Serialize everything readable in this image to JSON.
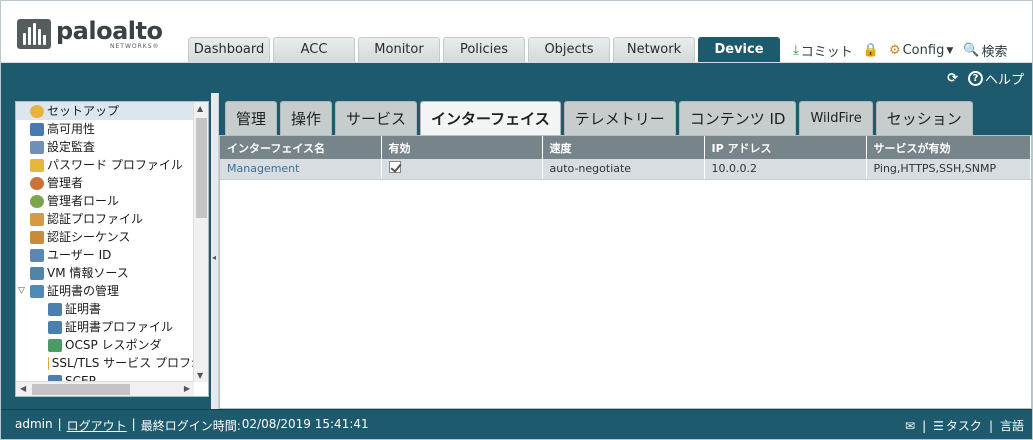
{
  "header": {
    "brand": "paloalto",
    "brand_sub": "NETWORKS®",
    "tabs": [
      {
        "label": "Dashboard"
      },
      {
        "label": "ACC"
      },
      {
        "label": "Monitor"
      },
      {
        "label": "Policies"
      },
      {
        "label": "Objects"
      },
      {
        "label": "Network"
      },
      {
        "label": "Device"
      }
    ],
    "commit_label": "コミット",
    "config_label": "Config",
    "search_label": "検索"
  },
  "band": {
    "help_label": "ヘルプ"
  },
  "sidebar": {
    "items": [
      {
        "label": "セットアップ",
        "icon": "setup-icon"
      },
      {
        "label": "高可用性",
        "icon": "high-availability-icon"
      },
      {
        "label": "設定監査",
        "icon": "config-audit-icon"
      },
      {
        "label": "パスワード プロファイル",
        "icon": "password-profile-icon"
      },
      {
        "label": "管理者",
        "icon": "admin-icon"
      },
      {
        "label": "管理者ロール",
        "icon": "admin-role-icon"
      },
      {
        "label": "認証プロファイル",
        "icon": "auth-profile-icon"
      },
      {
        "label": "認証シーケンス",
        "icon": "auth-sequence-icon"
      },
      {
        "label": "ユーザー ID",
        "icon": "user-id-icon"
      },
      {
        "label": "VM 情報ソース",
        "icon": "vm-info-icon"
      },
      {
        "label": "証明書の管理",
        "icon": "cert-management-icon"
      },
      {
        "label": "証明書",
        "icon": "certificate-icon"
      },
      {
        "label": "証明書プロファイル",
        "icon": "cert-profile-icon"
      },
      {
        "label": "OCSP レスポンダ",
        "icon": "ocsp-icon"
      },
      {
        "label": "SSL/TLS サービス プロフ:",
        "icon": "ssl-tls-icon"
      },
      {
        "label": "SCEP",
        "icon": "scep-icon"
      }
    ]
  },
  "subtabs": [
    {
      "label": "管理"
    },
    {
      "label": "操作"
    },
    {
      "label": "サービス"
    },
    {
      "label": "インターフェイス"
    },
    {
      "label": "テレメトリー"
    },
    {
      "label": "コンテンツ ID"
    },
    {
      "label": "WildFire"
    },
    {
      "label": "セッション"
    }
  ],
  "table": {
    "columns": [
      "インターフェイス名",
      "有効",
      "速度",
      "IP アドレス",
      "サービスが有効"
    ],
    "rows": [
      {
        "name": "Management",
        "enabled": true,
        "speed": "auto-negotiate",
        "ip": "10.0.0.2",
        "services": "Ping,HTTPS,SSH,SNMP"
      }
    ]
  },
  "footer": {
    "user": "admin",
    "logout": "ログアウト",
    "last_login_label": "最終ログイン時間:",
    "last_login_value": "02/08/2019 15:41:41",
    "tasks_label": "タスク",
    "language_label": "言語"
  },
  "colors": {
    "brand_blue": "#1e5a6e",
    "header_grey": "#77858b",
    "row_bg": "#d7dde0",
    "link": "#3f6f96"
  }
}
